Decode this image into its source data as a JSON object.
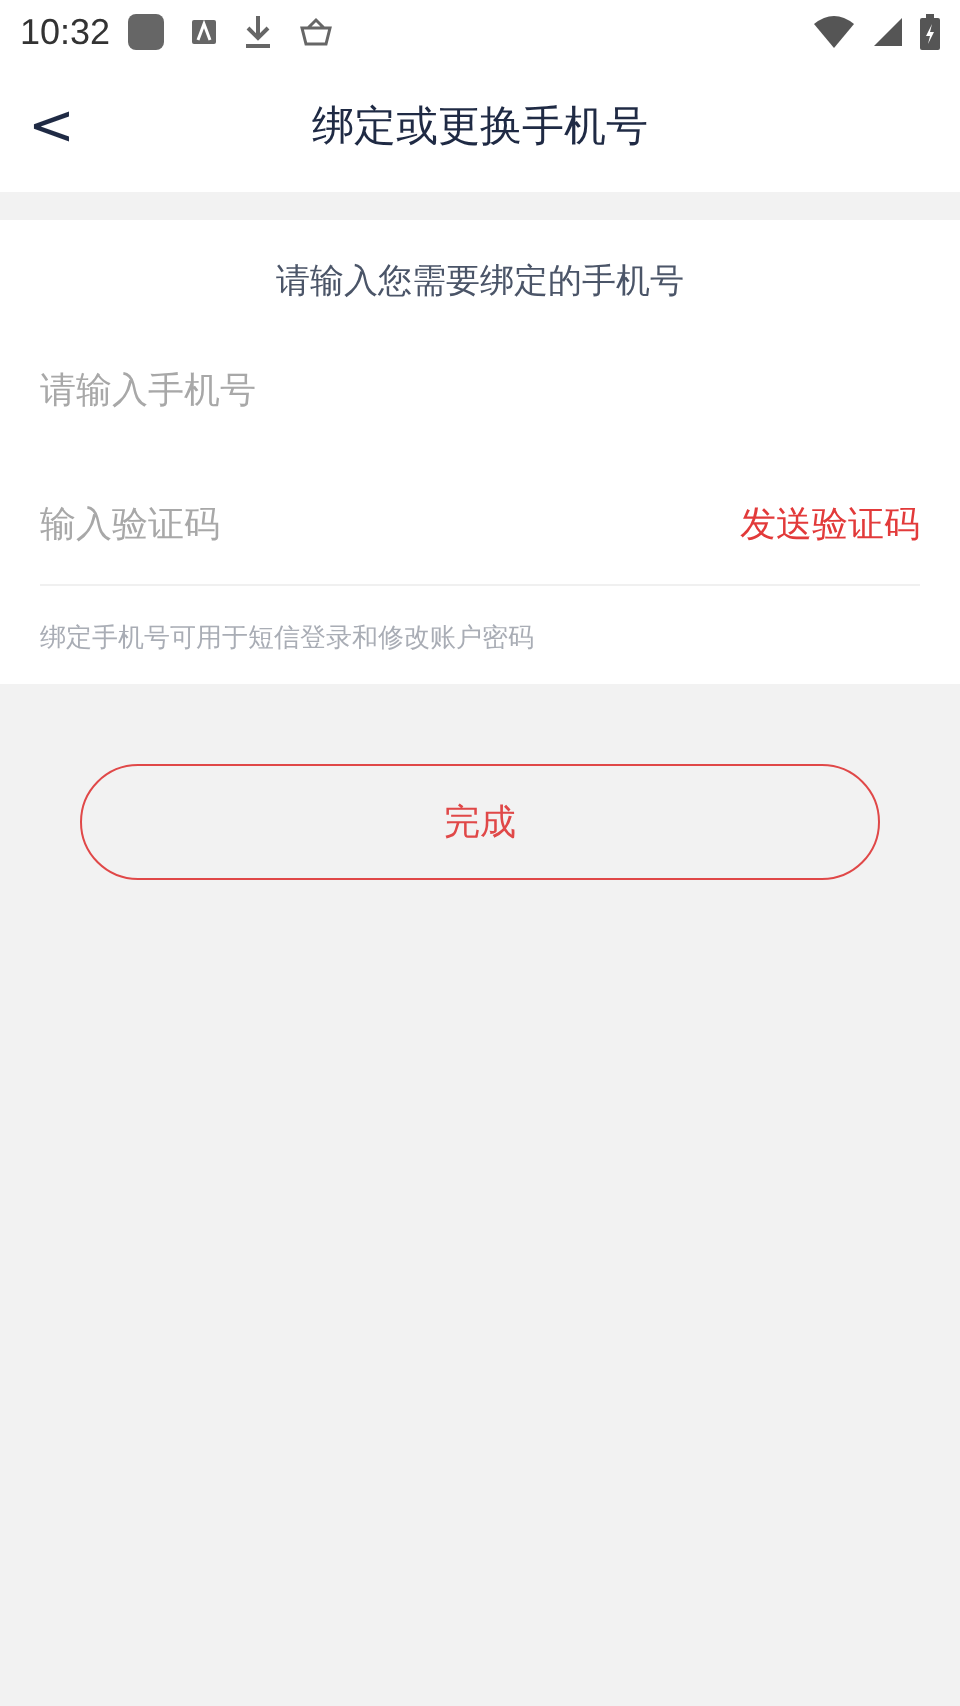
{
  "status_bar": {
    "time": "10:32"
  },
  "header": {
    "back": "<",
    "title": "绑定或更换手机号"
  },
  "form": {
    "prompt": "请输入您需要绑定的手机号",
    "phone": {
      "placeholder": "请输入手机号"
    },
    "code": {
      "placeholder": "输入验证码"
    },
    "send_code": "发送验证码",
    "hint": "绑定手机号可用于短信登录和修改账户密码"
  },
  "submit": "完成"
}
